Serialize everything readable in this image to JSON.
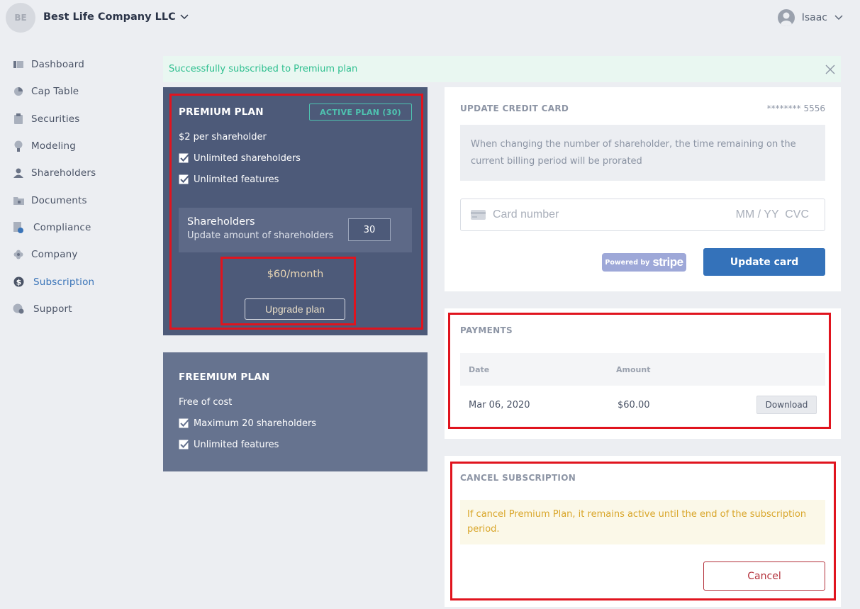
{
  "header": {
    "company_initials": "BE",
    "company_name": "Best Life Company LLC",
    "user_name": "Isaac"
  },
  "sidebar": {
    "items": [
      {
        "label": "Dashboard",
        "icon": "dashboard-icon"
      },
      {
        "label": "Cap Table",
        "icon": "pie-chart-icon"
      },
      {
        "label": "Securities",
        "icon": "clipboard-icon"
      },
      {
        "label": "Modeling",
        "icon": "lightbulb-icon"
      },
      {
        "label": "Shareholders",
        "icon": "person-icon"
      },
      {
        "label": "Documents",
        "icon": "folder-icon"
      },
      {
        "label": "Compliance",
        "icon": "document-check-icon"
      },
      {
        "label": "Company",
        "icon": "flower-icon"
      },
      {
        "label": "Subscription",
        "icon": "dollar-icon"
      },
      {
        "label": "Support",
        "icon": "support-icon"
      }
    ],
    "active": "Subscription"
  },
  "alert": {
    "message": "Successfully subscribed to Premium plan"
  },
  "premium_plan": {
    "title": "PREMIUM PLAN",
    "badge": "ACTIVE PLAN (30)",
    "price_line": "$2 per shareholder",
    "features": [
      "Unlimited shareholders",
      "Unlimited features"
    ],
    "shareholders_title": "Shareholders",
    "shareholders_subtitle": "Update amount of shareholders",
    "shareholders_value": "30",
    "monthly_price": "$60/month",
    "upgrade_label": "Upgrade plan"
  },
  "freemium_plan": {
    "title": "FREEMIUM PLAN",
    "price_line": "Free of cost",
    "features": [
      "Maximum 20 shareholders",
      "Unlimited features"
    ]
  },
  "credit_card": {
    "title": "UPDATE CREDIT CARD",
    "masked_number": "******** 5556",
    "info": "When changing the number of shareholder, the time remaining on the current billing period will be prorated",
    "card_placeholder": "Card number",
    "expiry_cvc_placeholder": "MM / YY  CVC",
    "powered_by": "Powered by",
    "stripe": "stripe",
    "update_label": "Update card"
  },
  "payments": {
    "title": "PAYMENTS",
    "columns": [
      "Date",
      "Amount"
    ],
    "rows": [
      {
        "date": "Mar 06, 2020",
        "amount": "$60.00",
        "action": "Download"
      }
    ]
  },
  "cancel_subscription": {
    "title": "CANCEL SUBSCRIPTION",
    "warning": "If cancel Premium Plan, it remains active until the end of the subscription period.",
    "cancel_label": "Cancel"
  },
  "colors": {
    "accent": "#3472ba",
    "premium_bg": "#4d5a79",
    "freemium_bg": "#66738f",
    "success": "#2ebf8f",
    "danger": "#b3303a",
    "highlight_frame": "#e0141e"
  }
}
